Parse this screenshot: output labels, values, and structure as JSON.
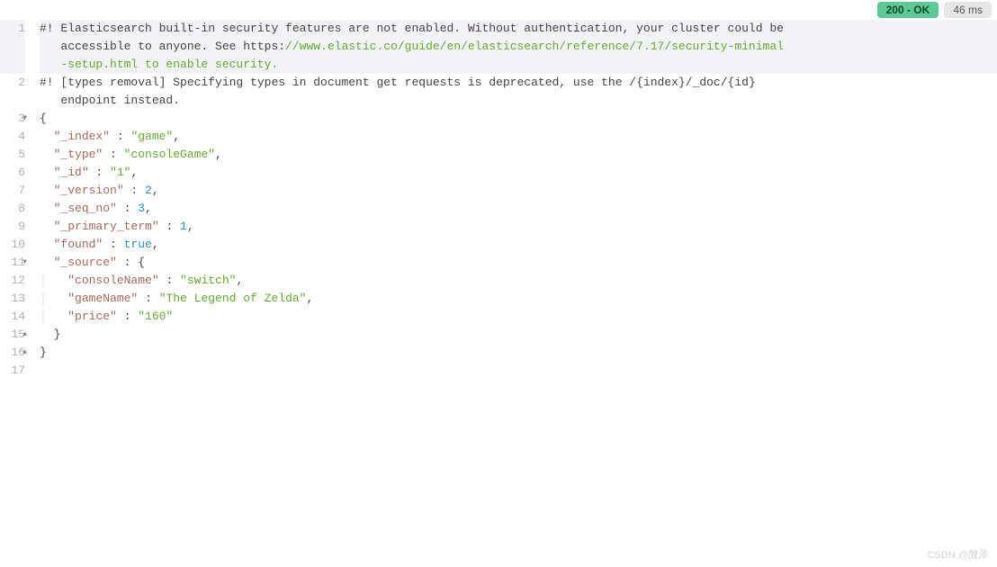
{
  "header": {
    "status": "200 - OK",
    "time": "46 ms"
  },
  "gutter": {
    "lines": [
      "1",
      "2",
      "3",
      "4",
      "5",
      "6",
      "7",
      "8",
      "9",
      "10",
      "11",
      "12",
      "13",
      "14",
      "15",
      "16",
      "17"
    ],
    "folds": {
      "3": "▼",
      "11": "▼",
      "15": "▲",
      "16": "▲"
    }
  },
  "code": {
    "line1_a": "#! Elasticsearch built-in security features are not enabled. Without authentication, your cluster could be",
    "line1_b": "   accessible to anyone. See https:",
    "line1_c": "//www.elastic.co/guide/en/elasticsearch/reference/7.17/security-minimal",
    "line1_d": "   -setup.html to enable security.",
    "line2_a": "#! [types removal] Specifying types in document get requests is deprecated, use the /{index}/_doc/{id}",
    "line2_b": "   endpoint instead.",
    "brace_open": "{",
    "brace_close": "}",
    "k_index": "\"_index\"",
    "v_index": "\"game\"",
    "k_type": "\"_type\"",
    "v_type": "\"consoleGame\"",
    "k_id": "\"_id\"",
    "v_id": "\"1\"",
    "k_version": "\"_version\"",
    "v_version": "2",
    "k_seqno": "\"_seq_no\"",
    "v_seqno": "3",
    "k_primary": "\"_primary_term\"",
    "v_primary": "1",
    "k_found": "\"found\"",
    "v_found": "true",
    "k_source": "\"_source\"",
    "k_console": "\"consoleName\"",
    "v_console": "\"switch\"",
    "k_game": "\"gameName\"",
    "v_game": "\"The Legend of Zelda\"",
    "k_price": "\"price\"",
    "v_price": "\"160\"",
    "colon": " : ",
    "comma": ",",
    "indent1": "  ",
    "indent2": "│   ",
    "indent2p": "    "
  },
  "watermark": "CSDN @醜泽"
}
